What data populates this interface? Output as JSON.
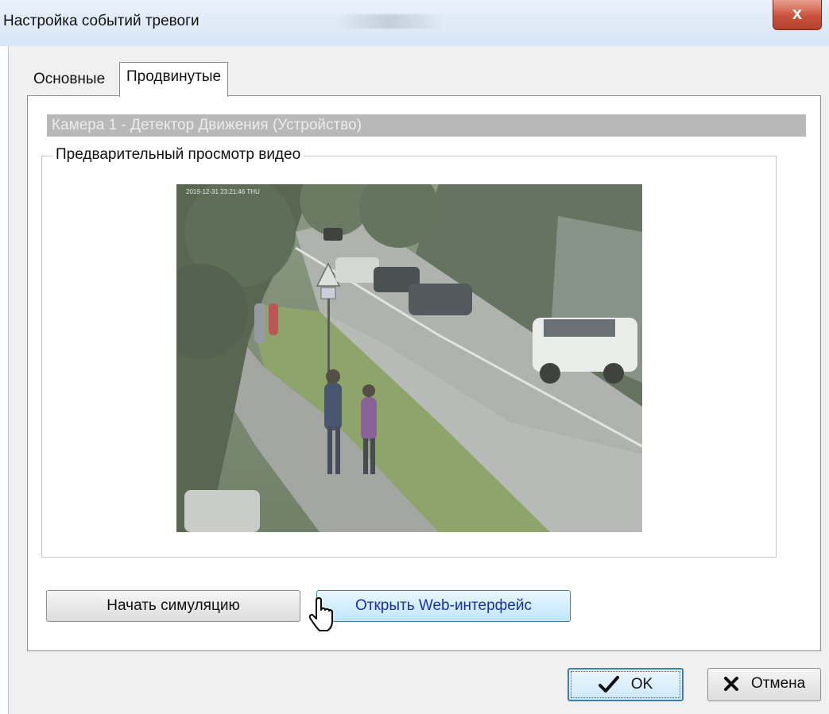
{
  "window": {
    "title": "Настройка событий тревоги",
    "close_label": "x"
  },
  "tabs": [
    {
      "label": "Основные",
      "active": false
    },
    {
      "label": "Продвинутые",
      "active": true
    }
  ],
  "camera_header": "Камера 1 - Детектор Движения (Устройство)",
  "preview": {
    "legend": "Предварительный просмотр видео",
    "timestamp": "2019-12-31 23:21:46 THU"
  },
  "buttons": {
    "simulate": "Начать симуляцию",
    "web": "Открыть Web-интерфейс",
    "ok": "OK",
    "cancel": "Отмена"
  },
  "icons": {
    "ok": "checkmark-icon",
    "cancel": "cross-icon",
    "cursor": "hand-pointer-icon"
  },
  "colors": {
    "camera_header_bg": "#b8b8b8",
    "web_button_text": "#1a2fa8",
    "close_button": "#c8523d"
  }
}
